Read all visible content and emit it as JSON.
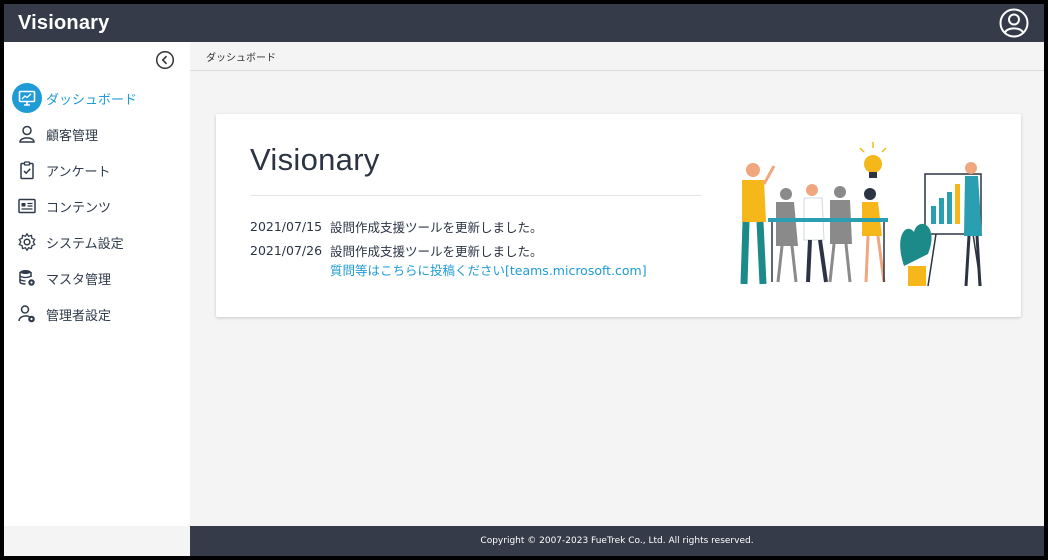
{
  "header": {
    "app_title": "Visionary",
    "account_icon": "user-circle-icon"
  },
  "sidebar": {
    "collapse_icon": "chevron-left-circle-icon",
    "items": [
      {
        "label": "ダッシュボード",
        "icon": "monitor-icon",
        "active": true
      },
      {
        "label": "顧客管理",
        "icon": "user-icon",
        "active": false
      },
      {
        "label": "アンケート",
        "icon": "clipboard-check-icon",
        "active": false
      },
      {
        "label": "コンテンツ",
        "icon": "id-card-icon",
        "active": false
      },
      {
        "label": "システム設定",
        "icon": "gear-icon",
        "active": false
      },
      {
        "label": "マスタ管理",
        "icon": "database-gear-icon",
        "active": false
      },
      {
        "label": "管理者設定",
        "icon": "user-gear-icon",
        "active": false
      }
    ]
  },
  "breadcrumb": {
    "current": "ダッシュボード"
  },
  "card": {
    "title": "Visionary",
    "news": [
      {
        "date": "2021/07/15",
        "text": "設問作成支援ツールを更新しました。"
      },
      {
        "date": "2021/07/26",
        "text": "設問作成支援ツールを更新しました。"
      }
    ],
    "link_text": "質問等はこちらに投稿ください[teams.microsoft.com]"
  },
  "colors": {
    "header_bg": "#353b48",
    "accent": "#1f9bd6",
    "page_bg": "#f4f4f5"
  },
  "footer": {
    "copyright": "Copyright © 2007-2023 FueTrek Co., Ltd. All rights reserved."
  }
}
